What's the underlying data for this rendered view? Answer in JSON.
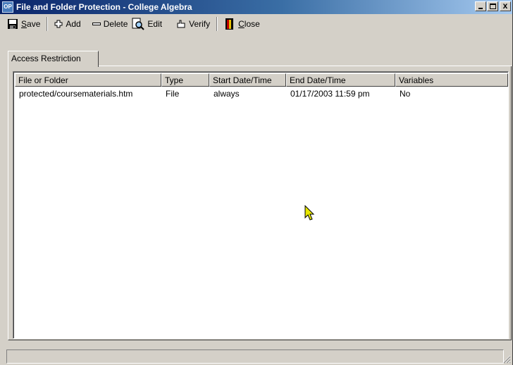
{
  "window": {
    "title": "File and Folder Protection - College Algebra",
    "app_icon_text": "OP"
  },
  "title_controls": {
    "minimize": "_",
    "maximize": "□",
    "close": "x"
  },
  "toolbar": {
    "save": {
      "prefix": "",
      "accel": "S",
      "suffix": "ave",
      "icon": "floppy-disk-icon"
    },
    "add": {
      "label": "Add",
      "icon": "plus-icon"
    },
    "delete": {
      "label": "Delete",
      "icon": "minus-icon"
    },
    "edit": {
      "label": "Edit",
      "icon": "magnifier-document-icon"
    },
    "verify": {
      "label": "Verify",
      "icon": "verify-hand-icon"
    },
    "close": {
      "prefix": "",
      "accel": "C",
      "suffix": "lose",
      "icon": "exit-door-icon"
    }
  },
  "tabs": [
    {
      "label": "Access Restriction",
      "active": true
    }
  ],
  "table": {
    "columns": [
      "File or Folder",
      "Type",
      "Start Date/Time",
      "End Date/Time",
      "Variables"
    ],
    "rows": [
      [
        "protected/coursematerials.htm",
        "File",
        "always",
        "01/17/2003 11:59 pm",
        "No"
      ]
    ]
  },
  "status": {
    "text": ""
  },
  "colors": {
    "title_start": "#0a246a",
    "title_end": "#a6caf0",
    "face": "#d4d0c8",
    "cursor": "#e8e800"
  }
}
